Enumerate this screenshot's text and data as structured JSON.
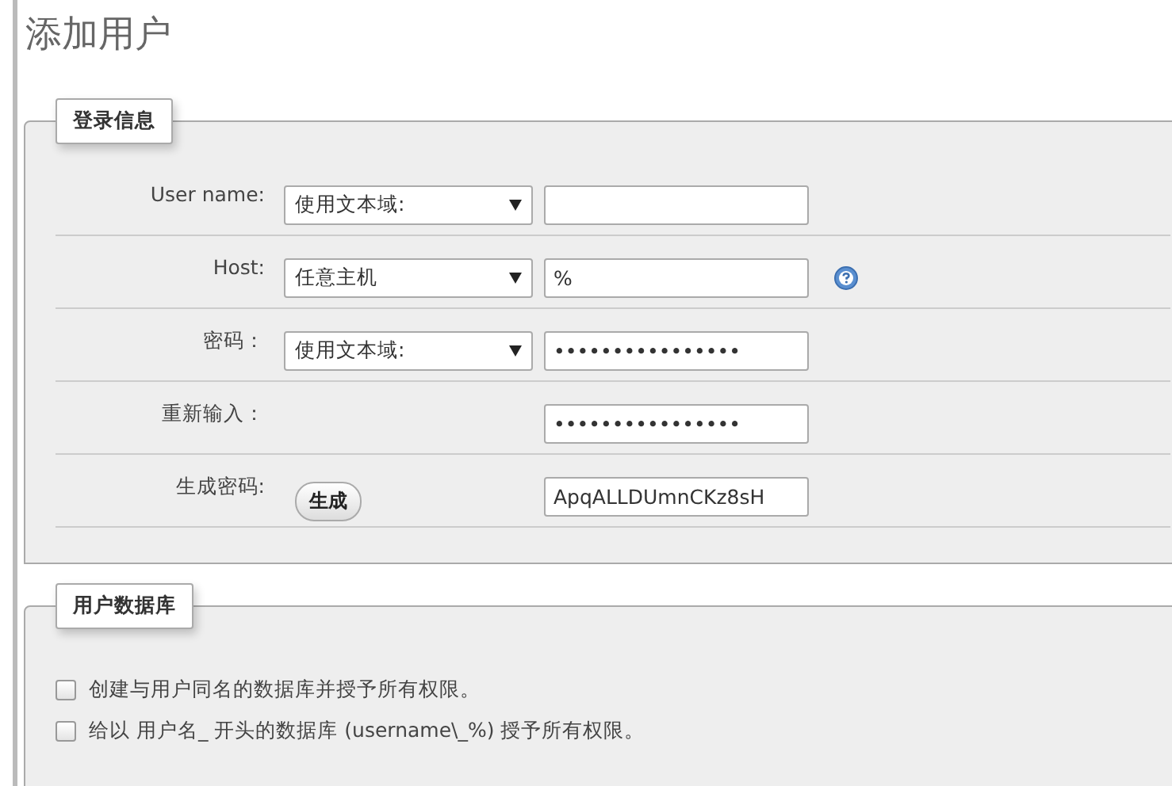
{
  "page_title": "添加用户",
  "login_section": {
    "legend": "登录信息",
    "rows": [
      {
        "kind": "select-input",
        "label": "User name:",
        "select": "使用文本域:",
        "value": "",
        "help": false
      },
      {
        "kind": "select-input",
        "label": "Host:",
        "select": "任意主机",
        "value": "%",
        "help": true
      },
      {
        "kind": "select-input",
        "label": "密码：",
        "select": "使用文本域:",
        "value": "••••••••••••••••",
        "help": false
      },
      {
        "kind": "input",
        "label": "重新输入：",
        "value": "••••••••••••••••",
        "help": false
      },
      {
        "kind": "button-input",
        "label": "生成密码:",
        "button": "生成",
        "value": "ApqALLDUmnCKz8sH",
        "help": false
      }
    ]
  },
  "database_section": {
    "legend": "用户数据库",
    "options": [
      {
        "label": "创建与用户同名的数据库并授予所有权限。",
        "checked": false
      },
      {
        "label": "给以 用户名_ 开头的数据库 (username\\_%) 授予所有权限。",
        "checked": false
      }
    ]
  }
}
